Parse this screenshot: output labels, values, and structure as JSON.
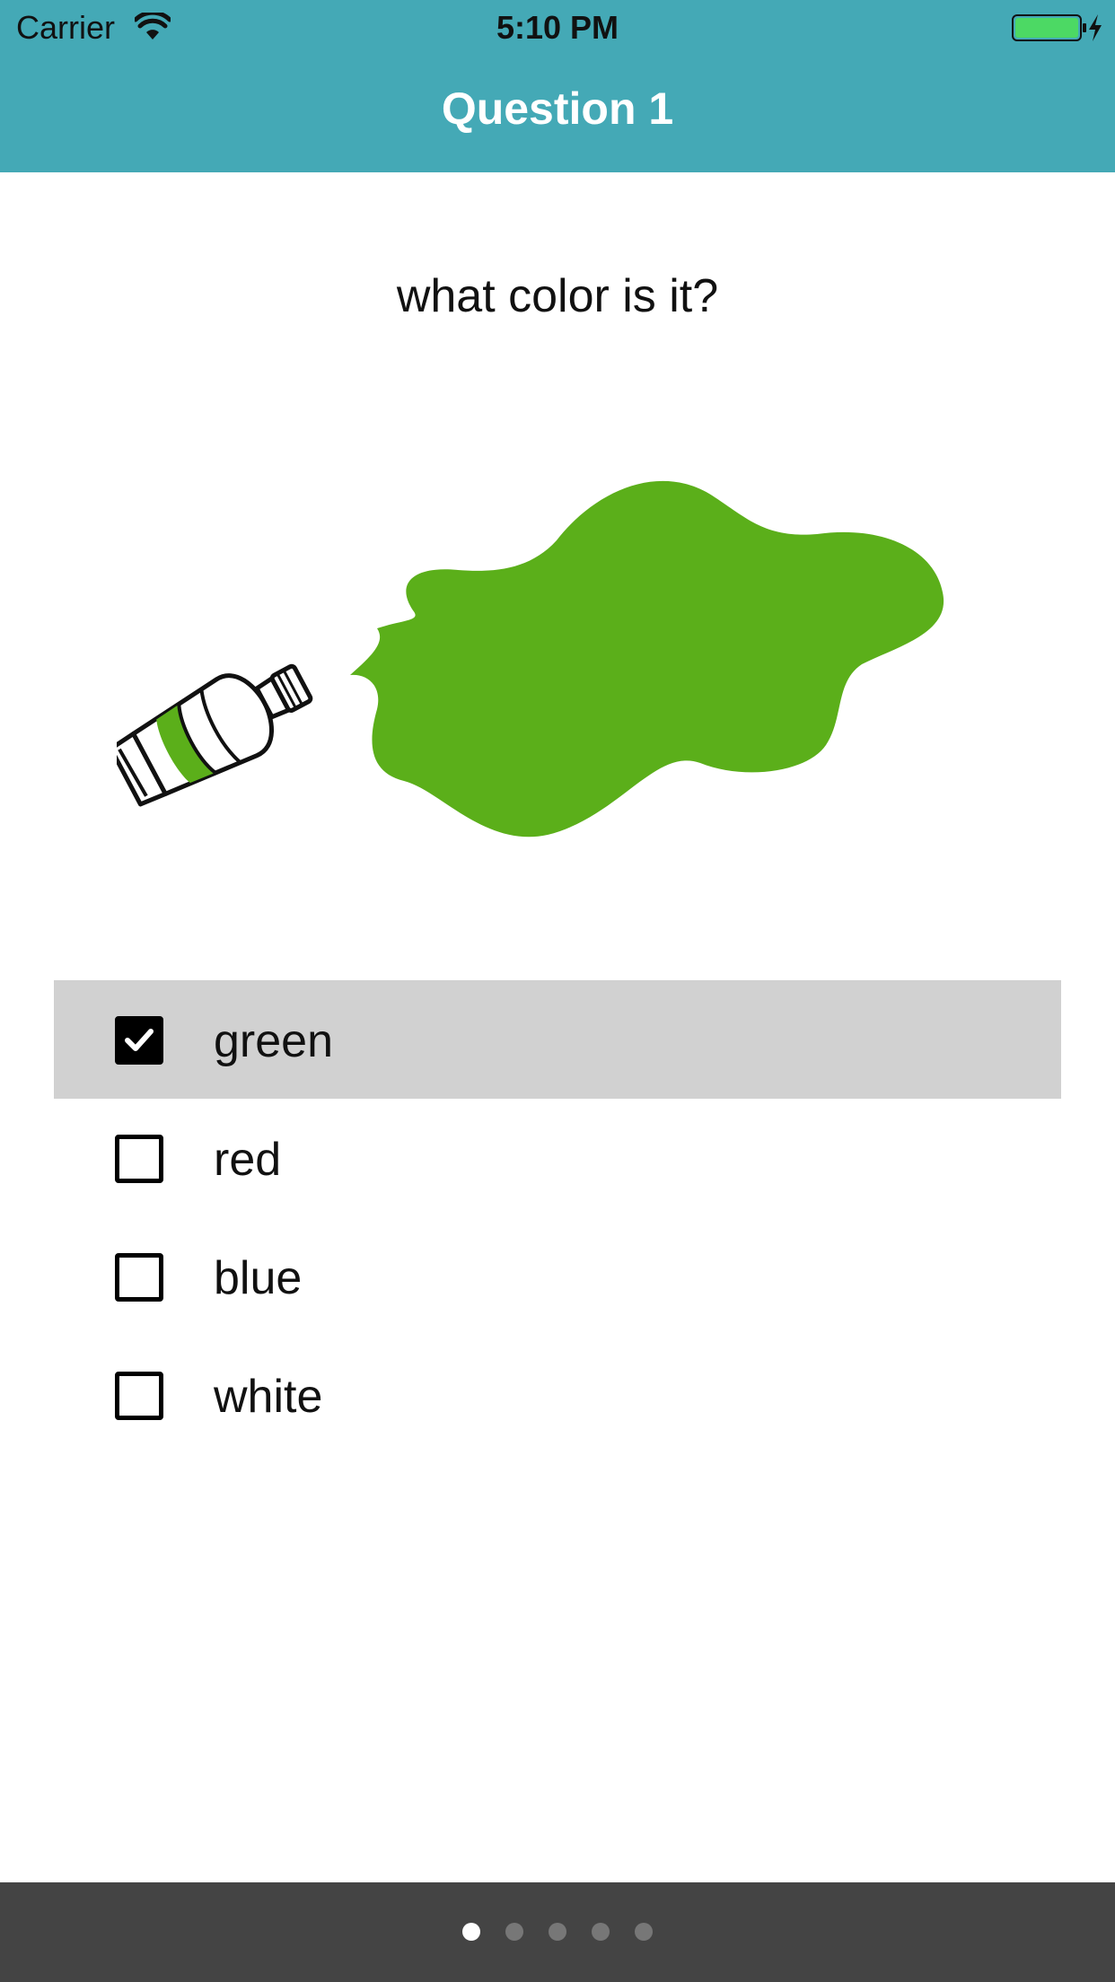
{
  "status_bar": {
    "carrier": "Carrier",
    "time": "5:10 PM",
    "battery_color": "#4cd964"
  },
  "nav": {
    "title": "Question 1",
    "background": "#44a9b6"
  },
  "question": {
    "text": "what color is it?",
    "image_icon": "paint-tube-splash",
    "paint_color": "#5baf1a"
  },
  "options": [
    {
      "label": "green",
      "checked": true
    },
    {
      "label": "red",
      "checked": false
    },
    {
      "label": "blue",
      "checked": false
    },
    {
      "label": "white",
      "checked": false
    }
  ],
  "pager": {
    "count": 5,
    "current": 1
  },
  "colors": {
    "selected_row": "#d1d1d1",
    "footer": "#444444"
  }
}
